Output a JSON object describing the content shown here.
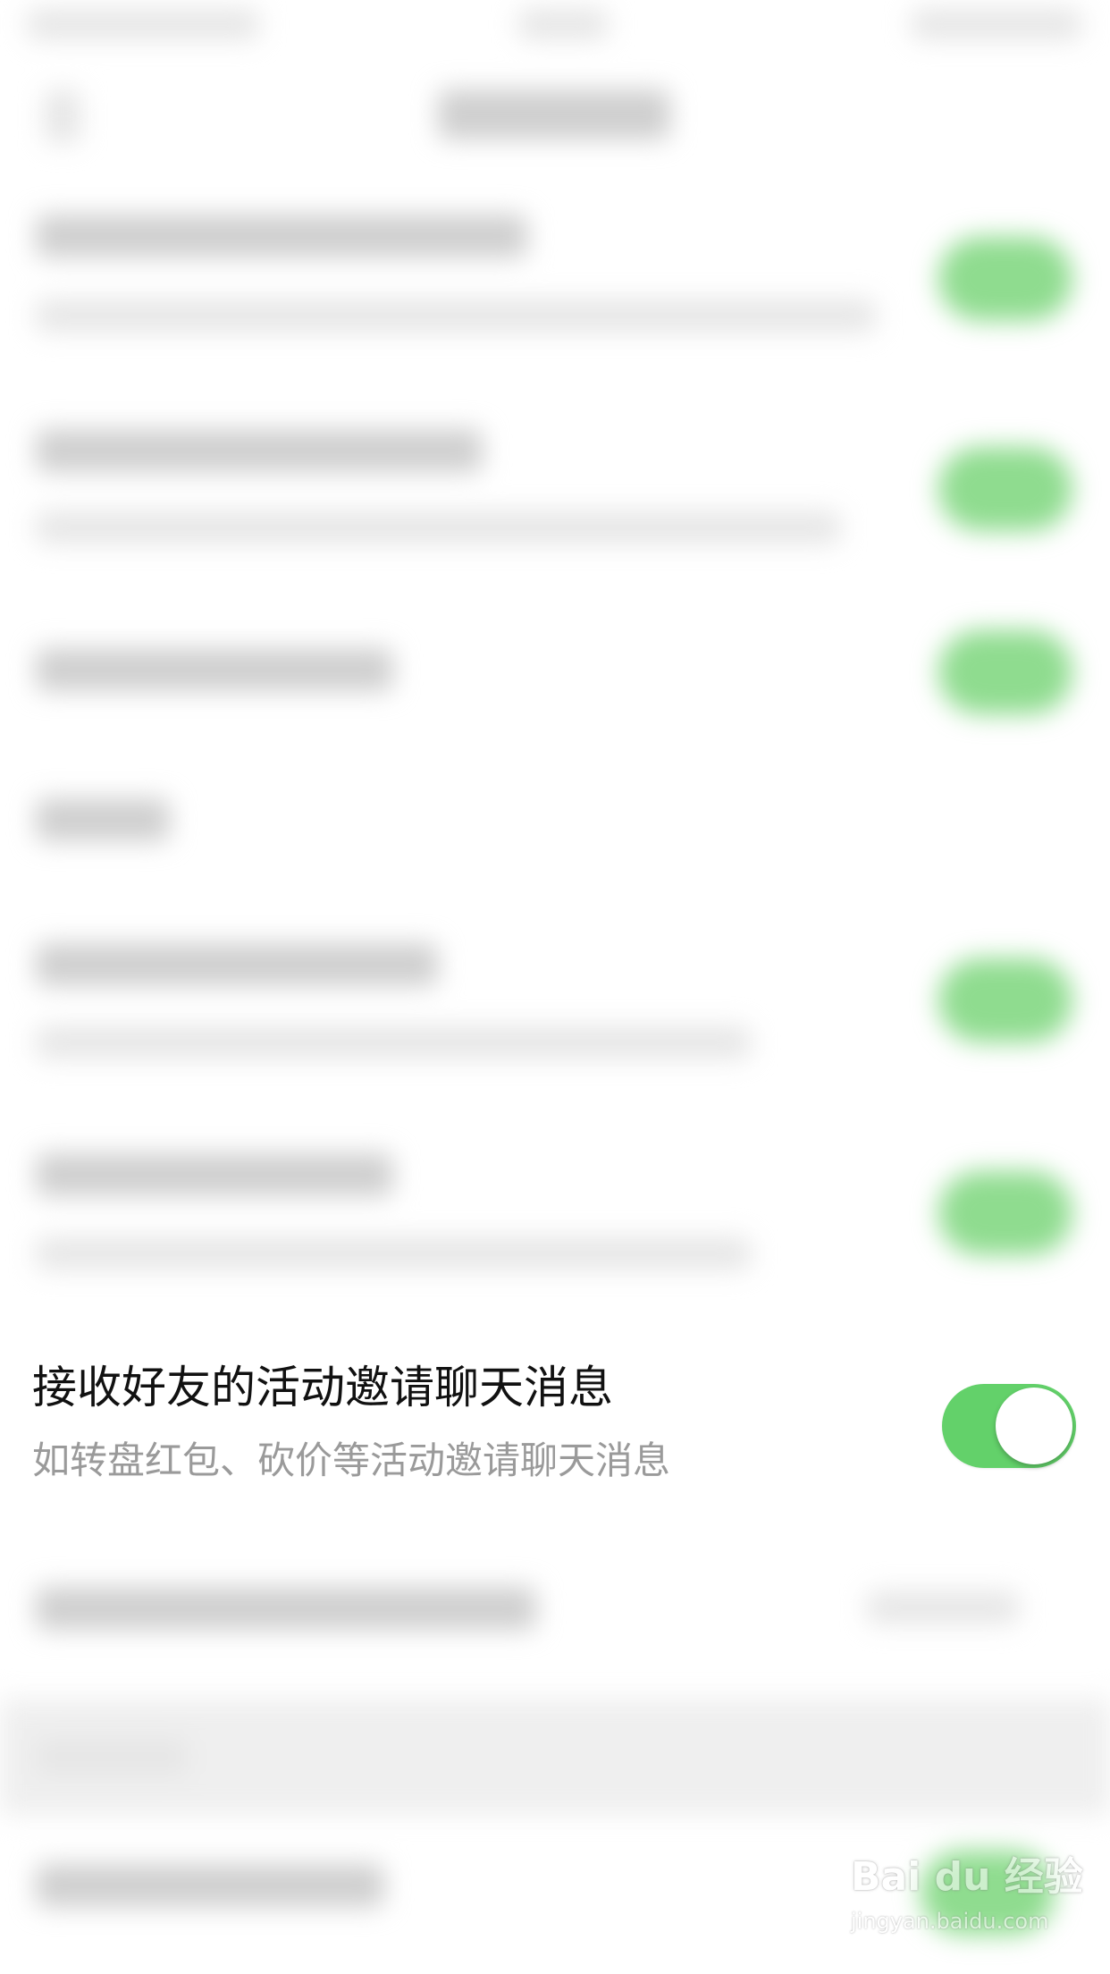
{
  "colors": {
    "toggle_on": "#63d16a",
    "title_text": "#111111",
    "desc_text": "#9a9a9a",
    "background": "#ffffff"
  },
  "focused_setting": {
    "title": "接收好友的活动邀请聊天消息",
    "description": "如转盘红包、砍价等活动邀请聊天消息",
    "toggle_state": "on"
  },
  "watermark": {
    "logo_text": "Bai du 经验",
    "url_text": "jingyan.baidu.com"
  }
}
